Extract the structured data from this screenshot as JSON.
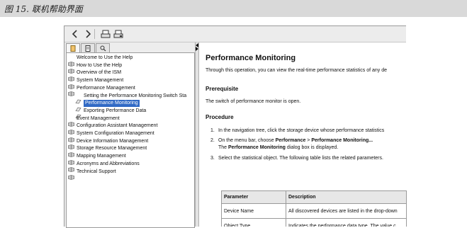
{
  "caption": "图 15. 联机帮助界面",
  "toolbar": {
    "icons": [
      "back-icon",
      "forward-icon",
      "print-icon",
      "print-setup-icon"
    ]
  },
  "tabs": [
    "contents-icon",
    "index-icon",
    "search-icon"
  ],
  "tree": {
    "items": [
      {
        "label": "Welcome to Use the Help",
        "level": 0
      },
      {
        "label": "How to Use the Help",
        "level": 0
      },
      {
        "label": "Overview of the ISM",
        "level": 0
      },
      {
        "label": "System Management",
        "level": 0
      },
      {
        "label": "Performance Management",
        "level": 0
      },
      {
        "label": "Setting the Performance Monitoring Switch Sta",
        "level": 1
      },
      {
        "label": "Performance Monitoring",
        "level": 1,
        "selected": true
      },
      {
        "label": "Exporting Performance Data",
        "level": 1
      },
      {
        "label": "Event Management",
        "level": 0
      },
      {
        "label": "Configuration Assistant Management",
        "level": 0
      },
      {
        "label": "System Configuration Management",
        "level": 0
      },
      {
        "label": "Device Information Management",
        "level": 0
      },
      {
        "label": "Storage Resource Management",
        "level": 0
      },
      {
        "label": "Mapping Management",
        "level": 0
      },
      {
        "label": "Acronyms and Abbreviations",
        "level": 0
      },
      {
        "label": "Technical Support",
        "level": 0
      }
    ]
  },
  "content": {
    "title": "Performance Monitoring",
    "intro": "Through this operation, you can view the real-time performance statistics of any de",
    "prereq_heading": "Prerequisite",
    "prereq_text": "The switch of performance monitor is open.",
    "procedure_heading": "Procedure",
    "steps": [
      {
        "num": "1.",
        "text": "In the navigation tree, click the storage device whose performance statistics"
      },
      {
        "num": "2.",
        "pre": "On the menu bar, choose ",
        "b1": "Performance",
        "mid": " > ",
        "b2": "Performance Monitoring...",
        "line2_pre": "The ",
        "line2_b": "Performance Monitoring",
        "line2_post": " dialog box is displayed."
      },
      {
        "num": "3.",
        "text": "Select the statistical object. The following table lists the related parameters."
      }
    ],
    "table": {
      "headers": [
        "Parameter",
        "Description"
      ],
      "rows": [
        [
          "Device Name",
          "All discovered devices are listed in the drop-down"
        ],
        [
          "Object Type",
          "Indicates the performance data type. The value c"
        ]
      ]
    }
  }
}
